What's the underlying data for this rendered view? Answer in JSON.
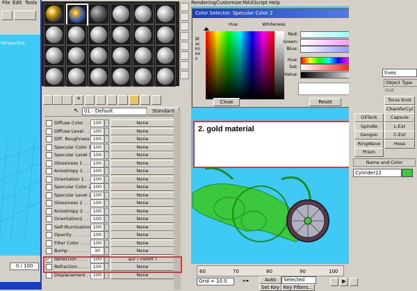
{
  "menubar": {
    "file": "File",
    "edit": "Edit",
    "tools": "Tools",
    "rendering": "Rendering",
    "customize": "Customize",
    "maxscript": "MAXScript",
    "help": "Help"
  },
  "left_viewport": {
    "label": "Perspective",
    "frame_counter": "0 / 100"
  },
  "material_editor": {
    "material_name": "01 - Default",
    "type_button": "Standard",
    "maps": [
      {
        "name": "Diffuse Color . . .",
        "amount": "100",
        "map": "None",
        "checked": false
      },
      {
        "name": "Diffuse Level . . .",
        "amount": "100",
        "map": "None",
        "checked": false
      },
      {
        "name": "Diff. Roughness",
        "amount": "100",
        "map": "None",
        "checked": false
      },
      {
        "name": "Specular Color 1",
        "amount": "100",
        "map": "None",
        "checked": false
      },
      {
        "name": "Specular Level 1",
        "amount": "100",
        "map": "None",
        "checked": false
      },
      {
        "name": "Glossiness 1 . . .",
        "amount": "100",
        "map": "None",
        "checked": false
      },
      {
        "name": "Anisotropy 1 . . .",
        "amount": "100",
        "map": "None",
        "checked": false
      },
      {
        "name": "Orientation 1 . . .",
        "amount": "100",
        "map": "None",
        "checked": false
      },
      {
        "name": "Specular Color 2",
        "amount": "100",
        "map": "None",
        "checked": false
      },
      {
        "name": "Specular Level 2",
        "amount": "100",
        "map": "None",
        "checked": false
      },
      {
        "name": "Glossiness 2 . . .",
        "amount": "100",
        "map": "None",
        "checked": false
      },
      {
        "name": "Anisotropy 2 . . .",
        "amount": "100",
        "map": "None",
        "checked": false
      },
      {
        "name": "Orientation2 . . .",
        "amount": "100",
        "map": "None",
        "checked": false
      },
      {
        "name": "Self-Illumination",
        "amount": "100",
        "map": "None",
        "checked": false
      },
      {
        "name": "Opacity . . . . . .",
        "amount": "100",
        "map": "None",
        "checked": false
      },
      {
        "name": "Filter Color . . . .",
        "amount": "100",
        "map": "None",
        "checked": false
      },
      {
        "name": "Bump . . . . . . .",
        "amount": "30",
        "map": "None",
        "checked": false
      },
      {
        "name": "Reflection . . . .",
        "amount": "100",
        "map": "aur ( Falloff )",
        "checked": true
      },
      {
        "name": "Refraction . . . .",
        "amount": "100",
        "map": "None",
        "checked": false
      },
      {
        "name": "Displacement . . .",
        "amount": "100",
        "map": "None",
        "checked": false
      }
    ]
  },
  "color_selector": {
    "title": "Color Selector: Specular Color 2",
    "hue_label": "Hue",
    "whiteness_label": "Whiteness",
    "blackness_label": "Blackness",
    "rows": [
      {
        "label": "Red:",
        "value": "255",
        "color": "#8ff"
      },
      {
        "label": "Green:",
        "value": "255",
        "color": "#f8f"
      },
      {
        "label": "Blue:",
        "value": "255",
        "color": "#88f"
      },
      {
        "label": "Hue:",
        "value": "0",
        "color": "#f00"
      },
      {
        "label": "Sat:",
        "value": "0",
        "color": "#f44"
      },
      {
        "label": "Value:",
        "value": "255",
        "color": "#fff"
      }
    ],
    "close_button": "Close",
    "reset_button": "Reset"
  },
  "annotation": {
    "text": "2. gold material",
    "color": "#d23a3a"
  },
  "command_panel": {
    "object_type_header": "Object Type",
    "grid_label": "Grid",
    "dropdown": "tives",
    "buttons": [
      "Torus Knot",
      "ChamferCyl",
      "Capsule",
      "L-Ext",
      "C-Ext",
      "Hose"
    ],
    "left_buttons": [
      "OilTank",
      "Spindle",
      "Gengon",
      "RingWave",
      "Prism"
    ],
    "name_color_header": "Name and Color",
    "object_name": "Cylinder22"
  },
  "timeline": {
    "ticks": [
      "60",
      "70",
      "80",
      "90",
      "100"
    ],
    "grid_label": "Grid = 10.0",
    "auto_key": "Auto Key",
    "selected": "Selected",
    "set_key": "Set Key",
    "key_filters": "Key Filters..."
  }
}
